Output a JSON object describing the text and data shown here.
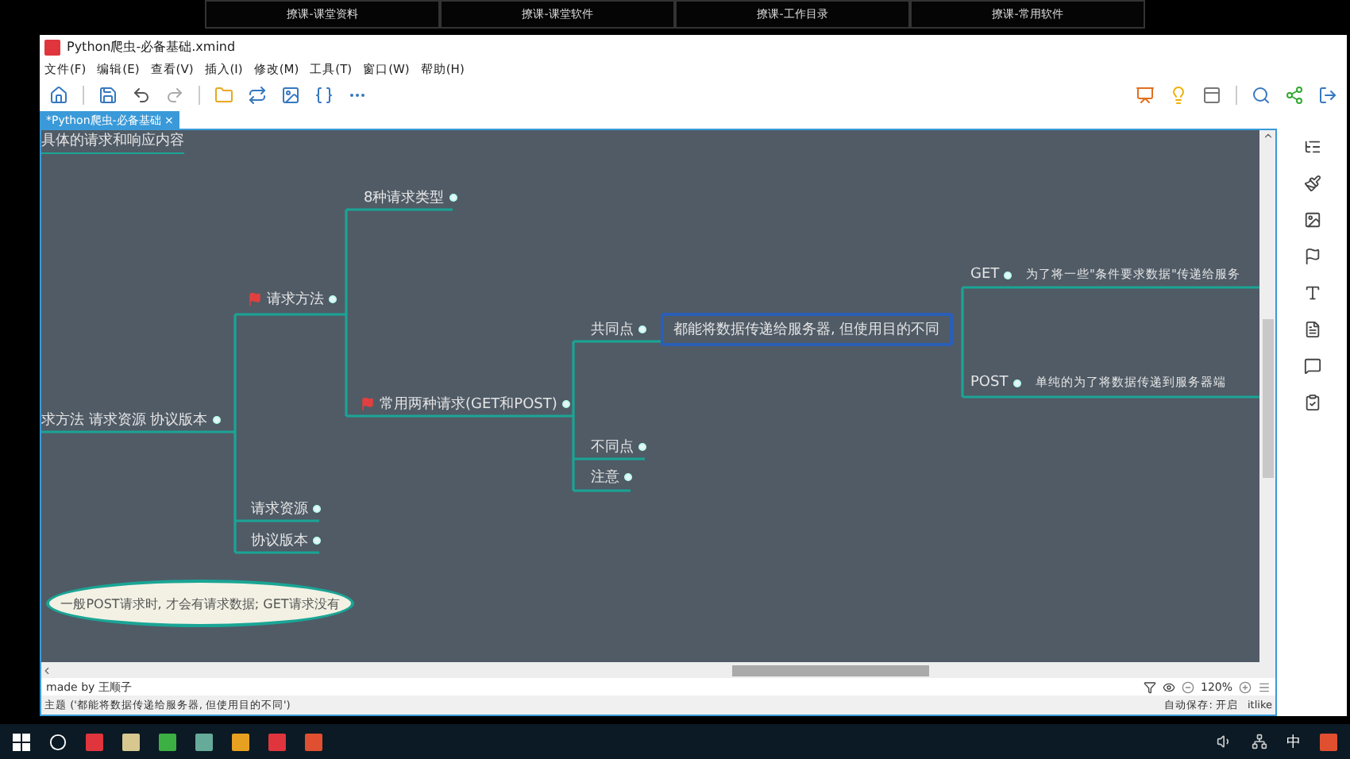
{
  "top_tabs": [
    "撩课-课堂资料",
    "撩课-课堂软件",
    "撩课-工作目录",
    "撩课-常用软件"
  ],
  "window": {
    "title": "Python爬虫-必备基础.xmind"
  },
  "menu": [
    "文件(F)",
    "编辑(E)",
    "查看(V)",
    "插入(I)",
    "修改(M)",
    "工具(T)",
    "窗口(W)",
    "帮助(H)"
  ],
  "doc_tab": {
    "label": "*Python爬虫-必备基础",
    "close": "×"
  },
  "map": {
    "top_cut_text": "具体的请求和响应内容",
    "root": {
      "text": "求方法 请求资源 协议版本",
      "flagged": false,
      "selected": false,
      "children": [
        {
          "text": "请求方法",
          "flagged": true,
          "selected": false,
          "children": [
            {
              "text": "8种请求类型",
              "flagged": false,
              "selected": false
            },
            {
              "text": "常用两种请求(GET和POST)",
              "flagged": true,
              "selected": false,
              "children": [
                {
                  "text": "共同点",
                  "flagged": false,
                  "selected": false,
                  "children": [
                    {
                      "text": "都能将数据传递给服务器, 但使用目的不同",
                      "flagged": false,
                      "selected": true,
                      "children": [
                        {
                          "text": "GET",
                          "flagged": false,
                          "selected": false,
                          "children": [
                            {
                              "text": "为了将一些\"条件要求数据\"传递给服务",
                              "flagged": false,
                              "selected": false
                            }
                          ]
                        },
                        {
                          "text": "POST",
                          "flagged": false,
                          "selected": false,
                          "children": [
                            {
                              "text": "单纯的为了将数据传递到服务器端",
                              "flagged": false,
                              "selected": false
                            }
                          ]
                        }
                      ]
                    }
                  ]
                },
                {
                  "text": "不同点",
                  "flagged": false,
                  "selected": false
                },
                {
                  "text": "注意",
                  "flagged": false,
                  "selected": false
                }
              ]
            }
          ]
        },
        {
          "text": "请求资源",
          "flagged": false,
          "selected": false
        },
        {
          "text": "协议版本",
          "flagged": false,
          "selected": false
        }
      ]
    },
    "callout": "一般POST请求时, 才会有请求数据; GET请求没有"
  },
  "footer": {
    "author": "made by 王顺子",
    "zoom": "120%"
  },
  "status_bar": {
    "topic": "主题 ('都能将数据传递给服务器, 但使用目的不同')",
    "autosave": "自动保存: 开启",
    "user": "itlike"
  },
  "taskbar": {
    "ime": "中"
  }
}
